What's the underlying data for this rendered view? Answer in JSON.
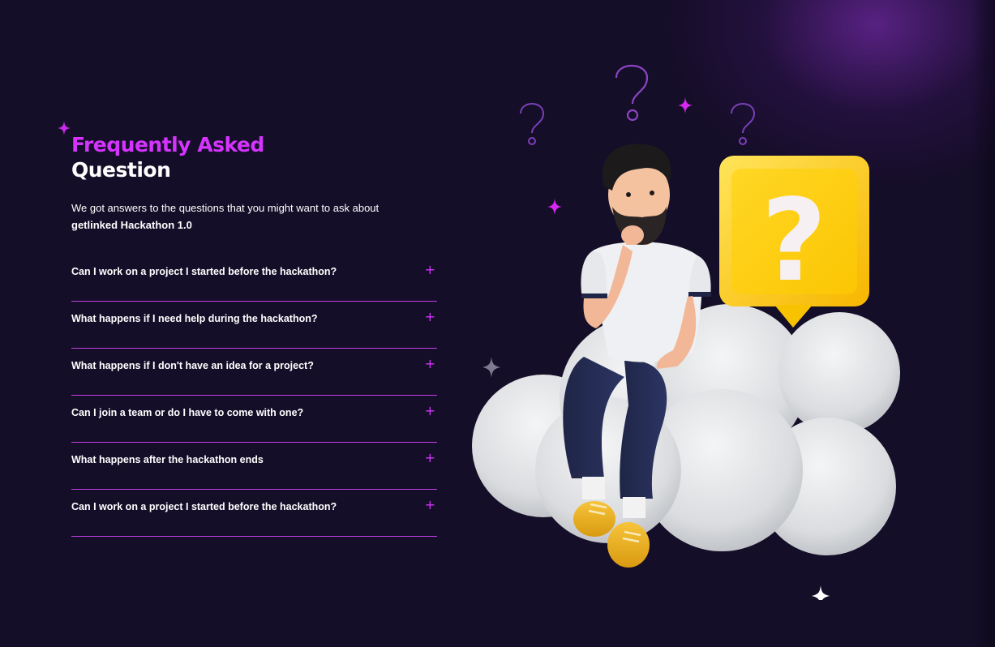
{
  "faq": {
    "title_accent": "Frequently Asked",
    "title_main": "Question",
    "intro_text": "We got answers to the questions that you might want to ask about",
    "intro_bold": "getlinked Hackathon 1.0",
    "expand_glyph": "+",
    "items": [
      {
        "question": "Can I work on a project I started before the hackathon?"
      },
      {
        "question": "What happens if I need help during the hackathon?"
      },
      {
        "question": "What happens if I don't have an idea for a project?"
      },
      {
        "question": "Can I join a team or do I have to come with one?"
      },
      {
        "question": "What happens after the hackathon ends"
      },
      {
        "question": "Can I work on a project I started before the hackathon?"
      }
    ]
  },
  "illustration": {
    "subject": "thinking-man-on-cloud",
    "bubble_glyph": "?",
    "question_glyph": "?"
  },
  "colors": {
    "background": "#150e28",
    "accent": "#d434fe",
    "text": "#ffffff",
    "divider": "#c43de6",
    "bubble": "#ffd23a"
  }
}
